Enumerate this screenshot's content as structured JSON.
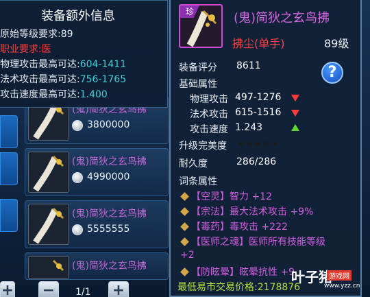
{
  "extra_info": {
    "title": "装备额外信息",
    "lines": [
      {
        "label": "原始等级要求:",
        "value": "89"
      },
      {
        "label": "职业要求:",
        "value": "医"
      },
      {
        "label": "物理攻击最高可达:",
        "value": "604-1411"
      },
      {
        "label": "法术攻击最高可达:",
        "value": "756-1765"
      },
      {
        "label": "攻击速度最高可达:",
        "value": "1.400"
      }
    ]
  },
  "market": {
    "rows": [
      {
        "name": "(鬼)简狄之玄鸟拂",
        "price": "3800000"
      },
      {
        "name": "(鬼)简狄之玄鸟拂",
        "price": "4990000"
      },
      {
        "name": "(鬼)简狄之玄鸟拂",
        "price": "5555555"
      },
      {
        "name": "(鬼)简狄之玄鸟拂",
        "price": ""
      }
    ],
    "pager": {
      "minus": "−",
      "page": "1/1",
      "plus": "+"
    }
  },
  "item": {
    "quality_tag": "珍",
    "name": "(鬼)简狄之玄鸟拂",
    "type": "拂尘(单手)",
    "level": "89级",
    "score_label": "装备评分",
    "score": "8611",
    "help": "?",
    "base_title": "基础属性",
    "phys_attack_label": "物理攻击",
    "phys_attack": "497-1276",
    "magic_attack_label": "法术攻击",
    "magic_attack": "615-1516",
    "speed_label": "攻击速度",
    "speed": "1.243",
    "upgrade_label": "升级完美度",
    "upgrade_stars": "★★★★★",
    "durability_label": "耐久度",
    "durability": "286/286",
    "affix_title": "词条属性",
    "affixes": [
      "【空灵】智力 +12",
      "【宗法】最大法术攻击 +9%",
      "【毒药】毒攻击 +222",
      "【医师之魂】医师所有技能等级",
      "+2",
      "【防眩晕】眩晕抗性 +9"
    ],
    "min_price_label": "最低易市交易价格:",
    "min_price": "2178876"
  },
  "watermark": {
    "name": "叶子猪",
    "sub": "游戏网",
    "url": "www.yzz.cn"
  },
  "colors": {
    "quality": "#d267e0",
    "attr_down": "#ff3b3b",
    "attr_up": "#5fd636",
    "price": "#b7e03a"
  }
}
